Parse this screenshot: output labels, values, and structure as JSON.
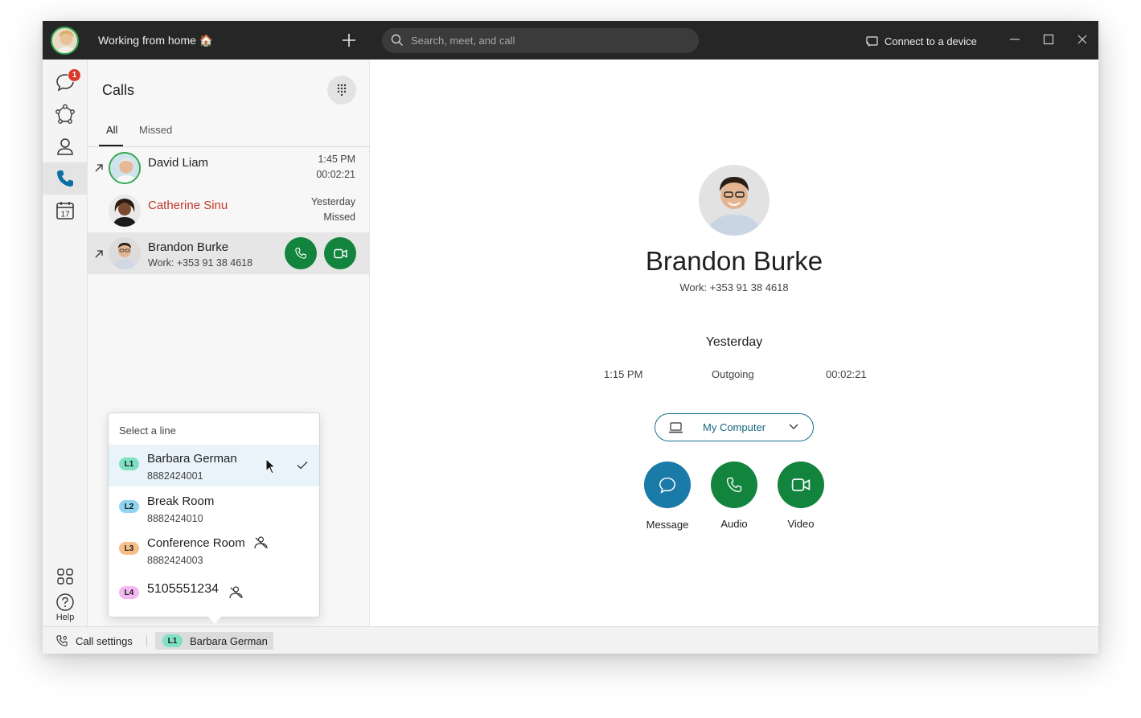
{
  "titlebar": {
    "status_text": "Working from home 🏠",
    "search_placeholder": "Search, meet, and call",
    "connect_label": "Connect to a device"
  },
  "rail": {
    "messages_badge": "1",
    "help_label": "Help",
    "calendar_day": "17"
  },
  "calls": {
    "title": "Calls",
    "tabs": [
      "All",
      "Missed"
    ],
    "rows": [
      {
        "name": "David Liam",
        "time": "1:45 PM",
        "detail": "00:02:21",
        "direction": "outgoing"
      },
      {
        "name": "Catherine Sinu",
        "time": "Yesterday",
        "detail": "Missed",
        "direction": "missed"
      },
      {
        "name": "Brandon Burke",
        "sub": "Work: +353 91 38 4618",
        "direction": "outgoing"
      }
    ]
  },
  "line_popup": {
    "title": "Select a line",
    "lines": [
      {
        "tag": "L1",
        "name": "Barbara German",
        "number": "8882424001",
        "color": "#7fe0c4"
      },
      {
        "tag": "L2",
        "name": "Break Room",
        "number": "8882424010",
        "color": "#8fd3f0"
      },
      {
        "tag": "L3",
        "name": "Conference Room",
        "number": "8882424003",
        "color": "#f7c08a"
      },
      {
        "tag": "L4",
        "name": "5105551234",
        "color": "#f3b8ef"
      }
    ]
  },
  "detail": {
    "name": "Brandon Burke",
    "sub": "Work: +353 91 38 4618",
    "when": "Yesterday",
    "time": "1:15 PM",
    "direction": "Outgoing",
    "duration": "00:02:21",
    "device": "My Computer",
    "actions": {
      "message": "Message",
      "audio": "Audio",
      "video": "Video"
    }
  },
  "bottombar": {
    "call_settings": "Call settings",
    "line_tag": "L1",
    "line_name": "Barbara German"
  },
  "colors": {
    "accent_green": "#12843e",
    "message_blue": "#1a7aa8",
    "missed_red": "#c0392b",
    "titlebar": "#262626"
  }
}
